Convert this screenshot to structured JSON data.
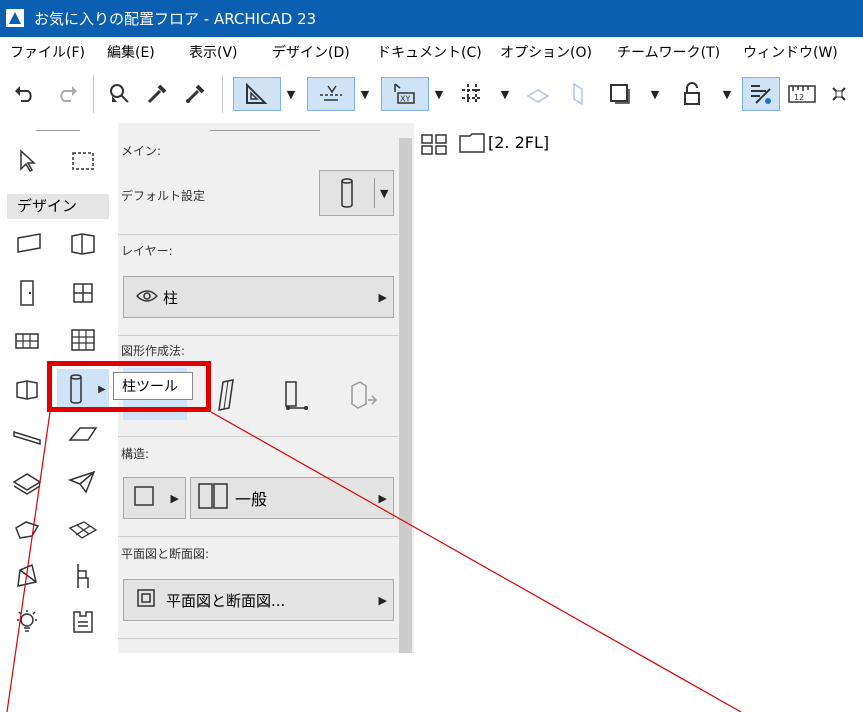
{
  "window": {
    "title": "お気に入りの配置フロア - ARCHICAD 23"
  },
  "menu": [
    "ファイル(F)",
    "編集(E)",
    "表示(V)",
    "デザイン(D)",
    "ドキュメント(C)",
    "オプション(O)",
    "チームワーク(T)",
    "ウィンドウ(W)"
  ],
  "toolbox": {
    "design_label": "デザイン"
  },
  "info_box": {
    "main_label": "メイン:",
    "default_settings": "デフォルト設定",
    "layer_label": "レイヤー:",
    "layer_value": "柱",
    "geometry_label": "図形作成法:",
    "structure_label": "構造:",
    "structure_value": "一般",
    "plan_section_label": "平面図と断面図:",
    "plan_section_value": "平面図と断面図..."
  },
  "tooltip": "柱ツール",
  "canvas": {
    "story": "[2. 2FL]"
  },
  "colors": {
    "titlebar": "#0a5fb0",
    "selected": "#cfe3f7",
    "highlight": "#e00000",
    "annotation_line": "#e00000"
  }
}
